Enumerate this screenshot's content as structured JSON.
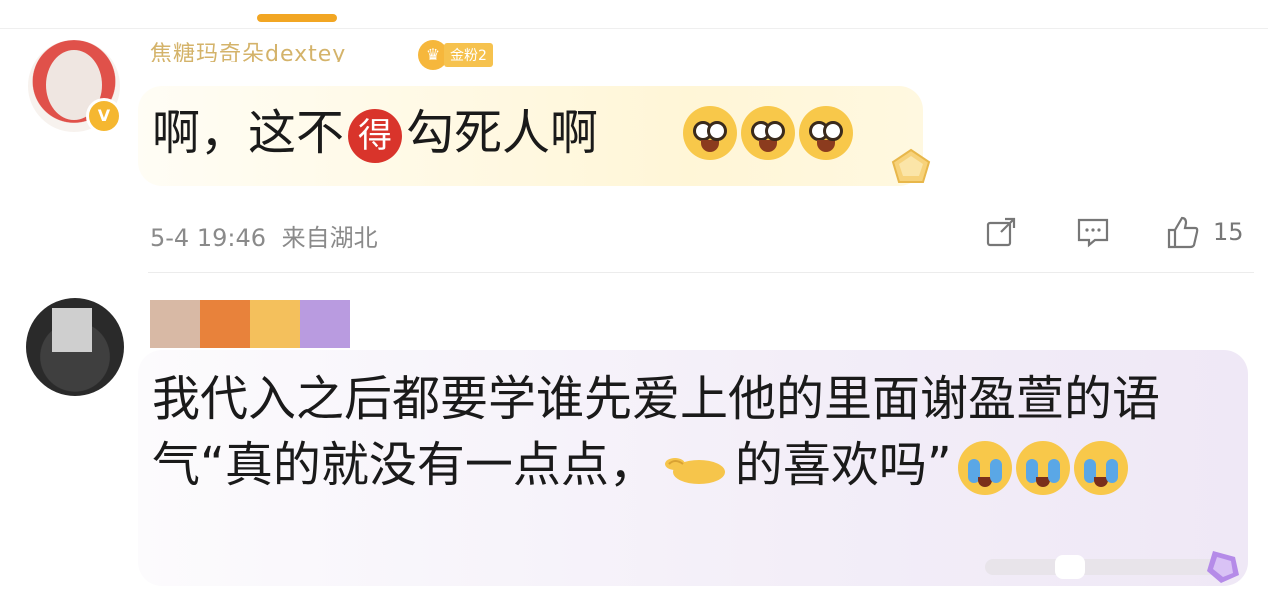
{
  "comment1": {
    "username": "焦糖玛奇朵dextey",
    "fan_badge": "金粉2",
    "verified_mark": "V",
    "text_before": "啊，这不",
    "de_badge": "得",
    "text_after": "勾死人啊",
    "emoji_count": 3,
    "timestamp": "5-4 19:46",
    "location": "来自湖北",
    "like_count": "15"
  },
  "comment2": {
    "text_main": "我代入之后都要学谁先爱上他的里面谢盈萱的语气“真的就没有一点点，",
    "text_end": "的喜欢吗”",
    "emoji_count": 3
  },
  "colors": {
    "accent": "#f2a623",
    "badge_red": "#d9342b",
    "gold": "#f6c24e",
    "meta_gray": "#8a8a8a",
    "name_strip": [
      "#d8b9a5",
      "#e8823b",
      "#f4c05c",
      "#b99be0"
    ]
  }
}
